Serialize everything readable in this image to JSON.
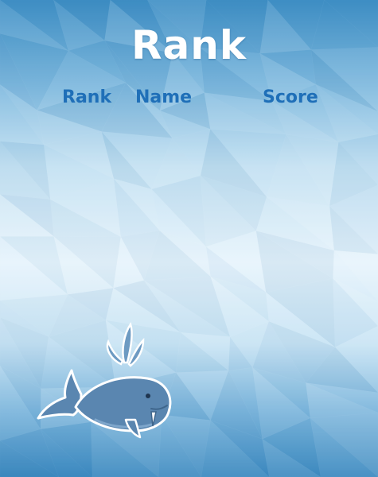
{
  "screen": {
    "title": "Rank"
  },
  "leaderboard": {
    "columns": {
      "rank": "Rank",
      "name": "Name",
      "score": "Score"
    },
    "rows": []
  },
  "colors": {
    "sea_dark": "#3f8fc5",
    "sea_light": "#d8edf8",
    "header_text": "#1f6fb8",
    "whale_body": "#5a86b0",
    "whale_spout": "#6d9ac2"
  },
  "icons": {
    "mascot": "whale-icon"
  }
}
